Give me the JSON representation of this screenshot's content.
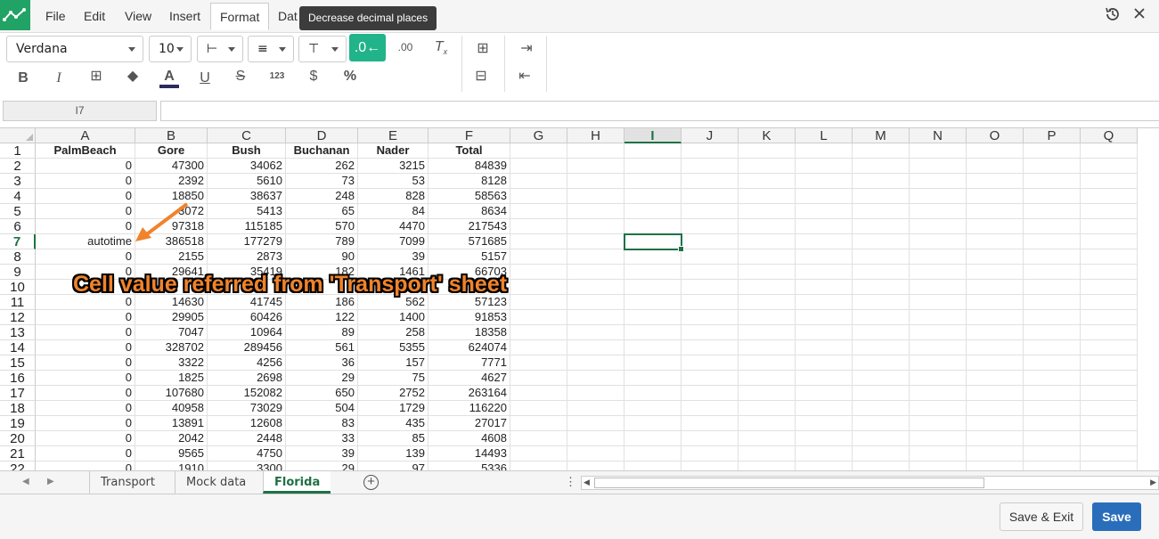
{
  "menu": {
    "items": [
      "File",
      "Edit",
      "View",
      "Insert",
      "Format",
      "Dat"
    ],
    "active": "Format",
    "tooltip": "Decrease decimal places"
  },
  "toolbar": {
    "font_family": "Verdana",
    "font_size": "10",
    "accent_color": "#21b38a"
  },
  "formula_bar": {
    "cell_ref": "I7",
    "value": ""
  },
  "grid": {
    "columns": [
      "A",
      "B",
      "C",
      "D",
      "E",
      "F",
      "G",
      "H",
      "I",
      "J",
      "K",
      "L",
      "M",
      "N",
      "O",
      "P",
      "Q"
    ],
    "selected_column": "I",
    "selected_row": "7",
    "rows": [
      {
        "n": "1",
        "cells": [
          "PalmBeach",
          "Gore",
          "Bush",
          "Buchanan",
          "Nader",
          "Total"
        ]
      },
      {
        "n": "2",
        "cells": [
          "0",
          "47300",
          "34062",
          "262",
          "3215",
          "84839"
        ]
      },
      {
        "n": "3",
        "cells": [
          "0",
          "2392",
          "5610",
          "73",
          "53",
          "8128"
        ]
      },
      {
        "n": "4",
        "cells": [
          "0",
          "18850",
          "38637",
          "248",
          "828",
          "58563"
        ]
      },
      {
        "n": "5",
        "cells": [
          "0",
          "3072",
          "5413",
          "65",
          "84",
          "8634"
        ]
      },
      {
        "n": "6",
        "cells": [
          "0",
          "97318",
          "115185",
          "570",
          "4470",
          "217543"
        ]
      },
      {
        "n": "7",
        "cells": [
          "autotime",
          "386518",
          "177279",
          "789",
          "7099",
          "571685"
        ]
      },
      {
        "n": "8",
        "cells": [
          "0",
          "2155",
          "2873",
          "90",
          "39",
          "5157"
        ]
      },
      {
        "n": "9",
        "cells": [
          "0",
          "29641",
          "35419",
          "182",
          "1461",
          "66703"
        ]
      },
      {
        "n": "10",
        "cells": [
          "",
          "",
          "",
          "",
          "",
          "93"
        ]
      },
      {
        "n": "11",
        "cells": [
          "0",
          "14630",
          "41745",
          "186",
          "562",
          "57123"
        ]
      },
      {
        "n": "12",
        "cells": [
          "0",
          "29905",
          "60426",
          "122",
          "1400",
          "91853"
        ]
      },
      {
        "n": "13",
        "cells": [
          "0",
          "7047",
          "10964",
          "89",
          "258",
          "18358"
        ]
      },
      {
        "n": "14",
        "cells": [
          "0",
          "328702",
          "289456",
          "561",
          "5355",
          "624074"
        ]
      },
      {
        "n": "15",
        "cells": [
          "0",
          "3322",
          "4256",
          "36",
          "157",
          "7771"
        ]
      },
      {
        "n": "16",
        "cells": [
          "0",
          "1825",
          "2698",
          "29",
          "75",
          "4627"
        ]
      },
      {
        "n": "17",
        "cells": [
          "0",
          "107680",
          "152082",
          "650",
          "2752",
          "263164"
        ]
      },
      {
        "n": "18",
        "cells": [
          "0",
          "40958",
          "73029",
          "504",
          "1729",
          "116220"
        ]
      },
      {
        "n": "19",
        "cells": [
          "0",
          "13891",
          "12608",
          "83",
          "435",
          "27017"
        ]
      },
      {
        "n": "20",
        "cells": [
          "0",
          "2042",
          "2448",
          "33",
          "85",
          "4608"
        ]
      },
      {
        "n": "21",
        "cells": [
          "0",
          "9565",
          "4750",
          "39",
          "139",
          "14493"
        ]
      },
      {
        "n": "22",
        "cells": [
          "0",
          "1910",
          "3300",
          "29",
          "97",
          "5336"
        ]
      }
    ]
  },
  "annotation": {
    "text": "Cell value referred from 'Transport' sheet",
    "color": "#f0832b"
  },
  "sheets": {
    "tabs": [
      "Transport",
      "Mock data",
      "Florida"
    ],
    "active": "Florida"
  },
  "footer": {
    "save_exit_label": "Save & Exit",
    "save_label": "Save"
  }
}
